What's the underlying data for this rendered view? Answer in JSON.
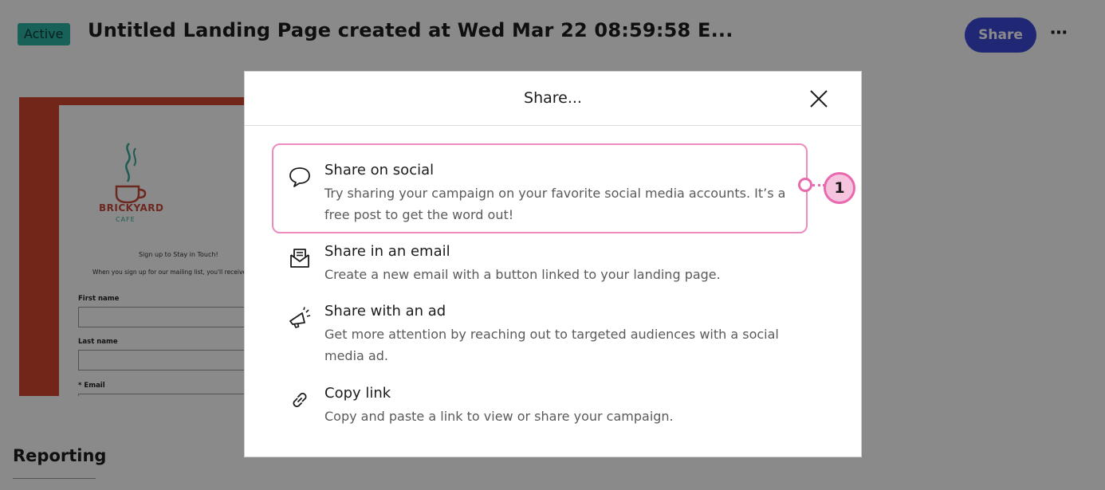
{
  "header": {
    "status": "Active",
    "title": "Untitled Landing Page created at Wed Mar 22 08:59:58 E...",
    "share_label": "Share",
    "more_label": "⋯"
  },
  "preview": {
    "logo_name": "BRICKYARD",
    "logo_sub": "CAFE",
    "signup_heading": "Sign up to Stay in Touch!",
    "signup_desc": "When you sign up for our mailing list, you'll receive a special offer",
    "fields": [
      {
        "label": "First name"
      },
      {
        "label": "Last name"
      },
      {
        "label": "* Email"
      }
    ],
    "colors": {
      "background": "#d2462f",
      "logo_text": "#c84a3a",
      "logo_sub": "#3aa89b"
    }
  },
  "reporting": {
    "label": "Reporting"
  },
  "modal": {
    "title": "Share...",
    "options": [
      {
        "icon": "speech-bubble-icon",
        "title": "Share on social",
        "desc": "Try sharing your campaign on your favorite social media accounts. It’s a free post to get the word out!"
      },
      {
        "icon": "envelope-icon",
        "title": "Share in an email",
        "desc": "Create a new email with a button linked to your landing page."
      },
      {
        "icon": "megaphone-icon",
        "title": "Share with an ad",
        "desc": "Get more attention by reaching out to targeted audiences with a social media ad."
      },
      {
        "icon": "link-icon",
        "title": "Copy link",
        "desc": "Copy and paste a link to view or share your campaign."
      }
    ]
  },
  "callout": {
    "number": "1",
    "color": "#e86aae"
  },
  "colors": {
    "accent": "#3b49d6",
    "active_badge": "#2bb3a5"
  }
}
